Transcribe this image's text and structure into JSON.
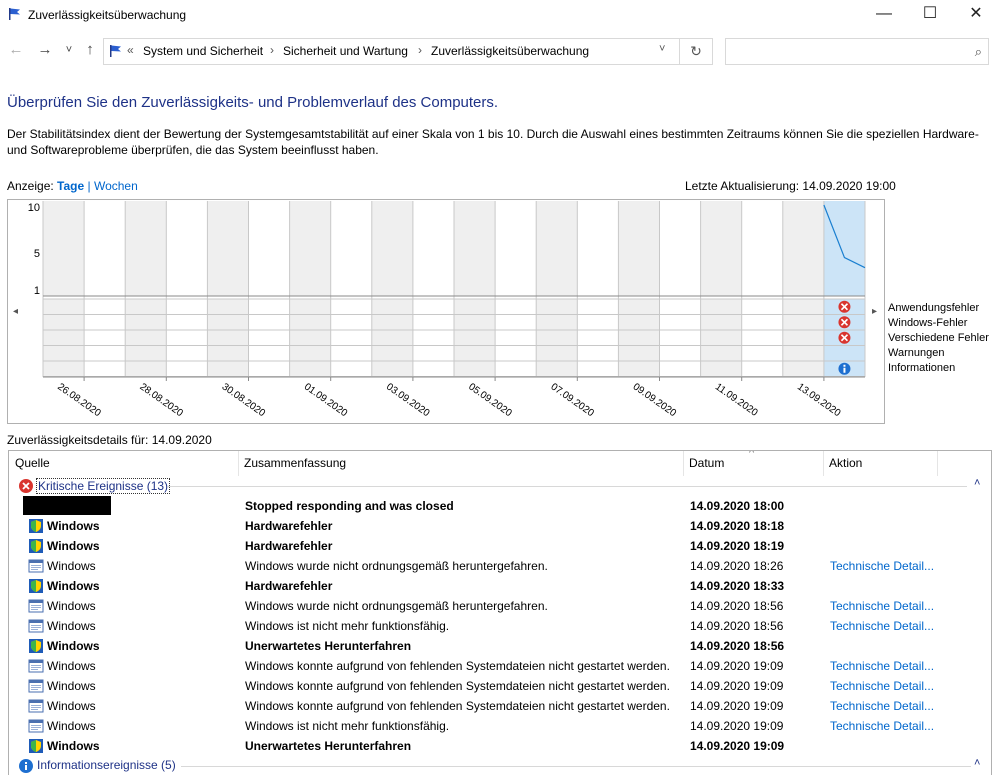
{
  "window": {
    "title": "Zuverlässigkeitsüberwachung",
    "minimize": "—",
    "maximize": "☐",
    "close": "✕"
  },
  "nav": {
    "back": "←",
    "forward": "→",
    "recent": "˅",
    "up": "↑",
    "overflow": "«",
    "breadcrumbs": [
      "System und Sicherheit",
      "Sicherheit und Wartung",
      "Zuverlässigkeitsüberwachung"
    ],
    "sep": "›",
    "dropdown": "˅",
    "refresh": "↻",
    "search_icon": "⌕",
    "search_placeholder": ""
  },
  "page": {
    "heading": "Überprüfen Sie den Zuverlässigkeits- und Problemverlauf des Computers.",
    "description": "Der Stabilitätsindex dient der Bewertung der Systemgesamtstabilität auf einer Skala von 1 bis 10. Durch die Auswahl eines bestimmten Zeitraums können Sie die speziellen Hardware- und Softwareprobleme überprüfen, die das System beeinflusst haben.",
    "view_label": "Anzeige: ",
    "view_days": "Tage",
    "view_sep": " | ",
    "view_weeks": "Wochen",
    "last_update": "Letzte Aktualisierung: 14.09.2020 19:00"
  },
  "chart_data": {
    "type": "line",
    "y_ticks": [
      "10",
      "5",
      "1"
    ],
    "ylim": [
      1,
      10
    ],
    "x_labels": [
      "26.08.2020",
      "28.08.2020",
      "30.08.2020",
      "01.09.2020",
      "03.09.2020",
      "05.09.2020",
      "07.09.2020",
      "09.09.2020",
      "11.09.2020",
      "13.09.2020"
    ],
    "stability_series": [
      {
        "x": "14.09.2020 00:00",
        "y": 10
      },
      {
        "x": "14.09.2020 12:00",
        "y": 4.3
      },
      {
        "x": "15.09.2020 00:00",
        "y": 3.2
      }
    ],
    "row_labels": [
      "Anwendungsfehler",
      "Windows-Fehler",
      "Verschiedene Fehler",
      "Warnungen",
      "Informationen"
    ],
    "events_on_selected_day": {
      "Anwendungsfehler": "error",
      "Windows-Fehler": "error",
      "Verschiedene Fehler": "error",
      "Warnungen": "",
      "Informationen": "info"
    },
    "line_color": "#1a7fd0",
    "selected_color": "#cce4f7"
  },
  "details": {
    "title": "Zuverlässigkeitsdetails für: 14.09.2020",
    "columns": {
      "source": "Quelle",
      "summary": "Zusammenfassung",
      "date": "Datum",
      "action": "Aktion"
    },
    "sort_glyph": "^",
    "group_critical": "Kritische Ereignisse (13)",
    "group_info": "Informationsereignisse (5)",
    "collapse_glyph": "˄",
    "rows": [
      {
        "icon": "app",
        "source": "",
        "summary": "Stopped responding and was closed",
        "date": "14.09.2020 18:00",
        "action": "",
        "bold": true,
        "redacted": true
      },
      {
        "icon": "shield",
        "source": "Windows",
        "summary": "Hardwarefehler",
        "date": "14.09.2020 18:18",
        "action": "",
        "bold": true
      },
      {
        "icon": "shield",
        "source": "Windows",
        "summary": "Hardwarefehler",
        "date": "14.09.2020 18:19",
        "action": "",
        "bold": true
      },
      {
        "icon": "window",
        "source": "Windows",
        "summary": "Windows wurde nicht ordnungsgemäß heruntergefahren.",
        "date": "14.09.2020 18:26",
        "action": "Technische Detail...",
        "bold": false
      },
      {
        "icon": "shield",
        "source": "Windows",
        "summary": "Hardwarefehler",
        "date": "14.09.2020 18:33",
        "action": "",
        "bold": true
      },
      {
        "icon": "window",
        "source": "Windows",
        "summary": "Windows wurde nicht ordnungsgemäß heruntergefahren.",
        "date": "14.09.2020 18:56",
        "action": "Technische Detail...",
        "bold": false
      },
      {
        "icon": "window",
        "source": "Windows",
        "summary": "Windows ist nicht mehr funktionsfähig.",
        "date": "14.09.2020 18:56",
        "action": "Technische Detail...",
        "bold": false
      },
      {
        "icon": "shield",
        "source": "Windows",
        "summary": "Unerwartetes Herunterfahren",
        "date": "14.09.2020 18:56",
        "action": "",
        "bold": true
      },
      {
        "icon": "window",
        "source": "Windows",
        "summary": "Windows konnte aufgrund von fehlenden Systemdateien nicht gestartet werden.",
        "date": "14.09.2020 19:09",
        "action": "Technische Detail...",
        "bold": false
      },
      {
        "icon": "window",
        "source": "Windows",
        "summary": "Windows konnte aufgrund von fehlenden Systemdateien nicht gestartet werden.",
        "date": "14.09.2020 19:09",
        "action": "Technische Detail...",
        "bold": false
      },
      {
        "icon": "window",
        "source": "Windows",
        "summary": "Windows konnte aufgrund von fehlenden Systemdateien nicht gestartet werden.",
        "date": "14.09.2020 19:09",
        "action": "Technische Detail...",
        "bold": false
      },
      {
        "icon": "window",
        "source": "Windows",
        "summary": "Windows ist nicht mehr funktionsfähig.",
        "date": "14.09.2020 19:09",
        "action": "Technische Detail...",
        "bold": false
      },
      {
        "icon": "shield",
        "source": "Windows",
        "summary": "Unerwartetes Herunterfahren",
        "date": "14.09.2020 19:09",
        "action": "",
        "bold": true
      }
    ]
  }
}
